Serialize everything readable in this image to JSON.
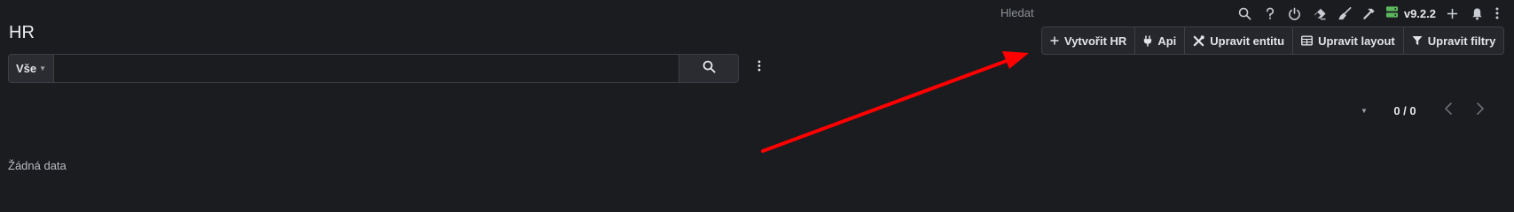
{
  "topbar": {
    "search_label": "Hledat",
    "version": "v9.2.2",
    "icons": [
      "search-icon",
      "help-icon",
      "power-icon",
      "eraser-icon",
      "broom-icon",
      "hammer-icon",
      "server-icon",
      "plus-icon",
      "bell-icon",
      "more-vertical-icon"
    ],
    "server_icon_color": "#5cb85c"
  },
  "header": {
    "title": "HR"
  },
  "actions": {
    "create_label": "Vytvořit HR",
    "api_label": "Api",
    "edit_entity_label": "Upravit entitu",
    "edit_layout_label": "Upravit layout",
    "edit_filters_label": "Upravit filtry"
  },
  "search": {
    "filter_value": "Vše",
    "query": "",
    "placeholder": ""
  },
  "pagination": {
    "count_text": "0 / 0"
  },
  "content": {
    "empty_text": "Žádná data"
  },
  "colors": {
    "background": "#1b1c20",
    "annotation_arrow": "#ff0000"
  }
}
